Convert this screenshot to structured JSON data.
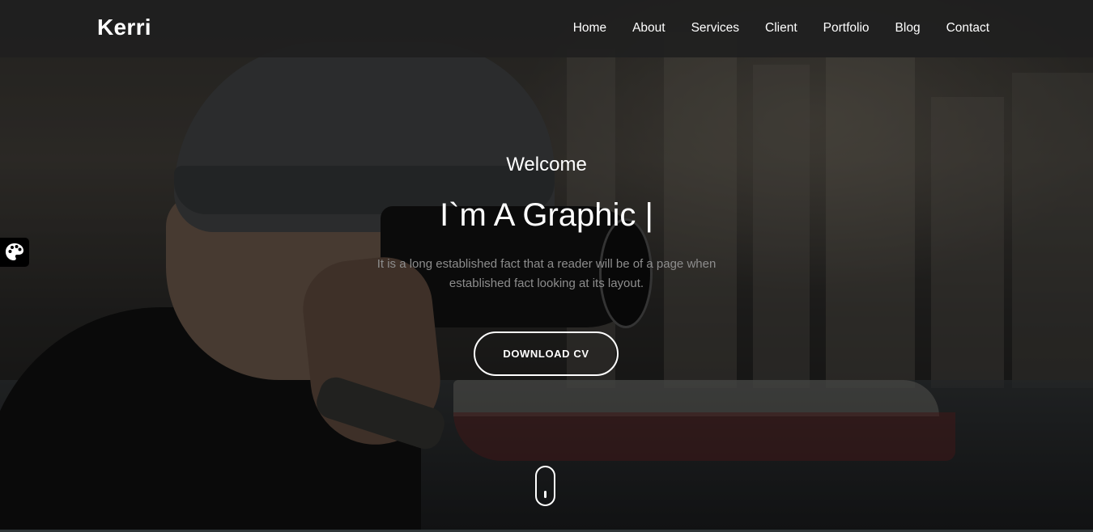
{
  "brand": {
    "logo_text": "Kerri"
  },
  "nav": {
    "items": [
      {
        "label": "Home"
      },
      {
        "label": "About"
      },
      {
        "label": "Services"
      },
      {
        "label": "Client"
      },
      {
        "label": "Portfolio"
      },
      {
        "label": "Blog"
      },
      {
        "label": "Contact"
      }
    ]
  },
  "hero": {
    "welcome": "Welcome",
    "headline": "I`m A Graphic |",
    "description": "It is a long established fact that a reader will be of a page when established fact looking at its layout.",
    "cta_label": "DOWNLOAD CV"
  },
  "widgets": {
    "color_switcher_icon": "palette-icon",
    "scroll_indicator_icon": "mouse-scroll-icon"
  },
  "colors": {
    "navbar_bg": "#202020",
    "description_text": "#8d8d8d",
    "button_border": "#ffffff"
  }
}
